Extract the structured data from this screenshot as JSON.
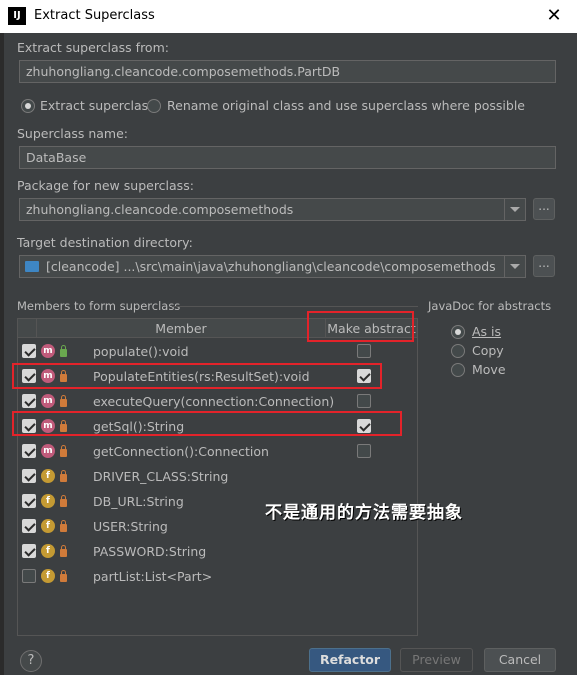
{
  "window": {
    "app_icon": "IJ",
    "title": "Extract Superclass",
    "close": "✕"
  },
  "source": {
    "label": "Extract superclass from:",
    "value": "zhuhongliang.cleancode.composemethods.PartDB"
  },
  "mode": {
    "extract_label": "Extract superclass",
    "rename_label": "Rename original class and use superclass where possible",
    "selected": "extract"
  },
  "superclass_name": {
    "label": "Superclass name:",
    "value": "DataBase"
  },
  "package": {
    "label": "Package for new superclass:",
    "value": "zhuhongliang.cleancode.composemethods",
    "browse": "..."
  },
  "target_dir": {
    "label": "Target destination directory:",
    "value": "[cleancode] ...\\src\\main\\java\\zhuhongliang\\cleancode\\composemethods",
    "browse": "..."
  },
  "members": {
    "label": "Members to form superclass",
    "col_member": "Member",
    "col_abstract": "Make abstract",
    "rows": [
      {
        "kind": "m",
        "lock": "open",
        "checked": true,
        "signature": "populate():void",
        "abstract_enabled": true,
        "abstract": false
      },
      {
        "kind": "m",
        "lock": "private",
        "checked": true,
        "signature": "PopulateEntities(rs:ResultSet):void",
        "abstract_enabled": true,
        "abstract": true
      },
      {
        "kind": "m",
        "lock": "private",
        "checked": true,
        "signature": "executeQuery(connection:Connection)",
        "abstract_enabled": true,
        "abstract": false
      },
      {
        "kind": "m",
        "lock": "private",
        "checked": true,
        "signature": "getSql():String",
        "abstract_enabled": true,
        "abstract": true
      },
      {
        "kind": "m",
        "lock": "private",
        "checked": true,
        "signature": "getConnection():Connection",
        "abstract_enabled": true,
        "abstract": false
      },
      {
        "kind": "f",
        "lock": "private",
        "checked": true,
        "signature": "DRIVER_CLASS:String",
        "abstract_enabled": false,
        "abstract": false
      },
      {
        "kind": "f",
        "lock": "private",
        "checked": true,
        "signature": "DB_URL:String",
        "abstract_enabled": false,
        "abstract": false
      },
      {
        "kind": "f",
        "lock": "private",
        "checked": true,
        "signature": "USER:String",
        "abstract_enabled": false,
        "abstract": false
      },
      {
        "kind": "f",
        "lock": "private",
        "checked": true,
        "signature": "PASSWORD:String",
        "abstract_enabled": false,
        "abstract": false
      },
      {
        "kind": "f",
        "lock": "private",
        "checked": false,
        "signature": "partList:List<Part>",
        "abstract_enabled": false,
        "abstract": false
      }
    ]
  },
  "javadoc": {
    "label": "JavaDoc for abstracts",
    "options": [
      "As is",
      "Copy",
      "Move"
    ],
    "selected": "As is"
  },
  "annotation": "不是通用的方法需要抽象",
  "buttons": {
    "help": "?",
    "refactor": "Refactor",
    "preview": "Preview",
    "cancel": "Cancel"
  },
  "colors": {
    "background": "#3c3f41",
    "primary_button": "#365880",
    "highlight_box": "#e3232a"
  }
}
